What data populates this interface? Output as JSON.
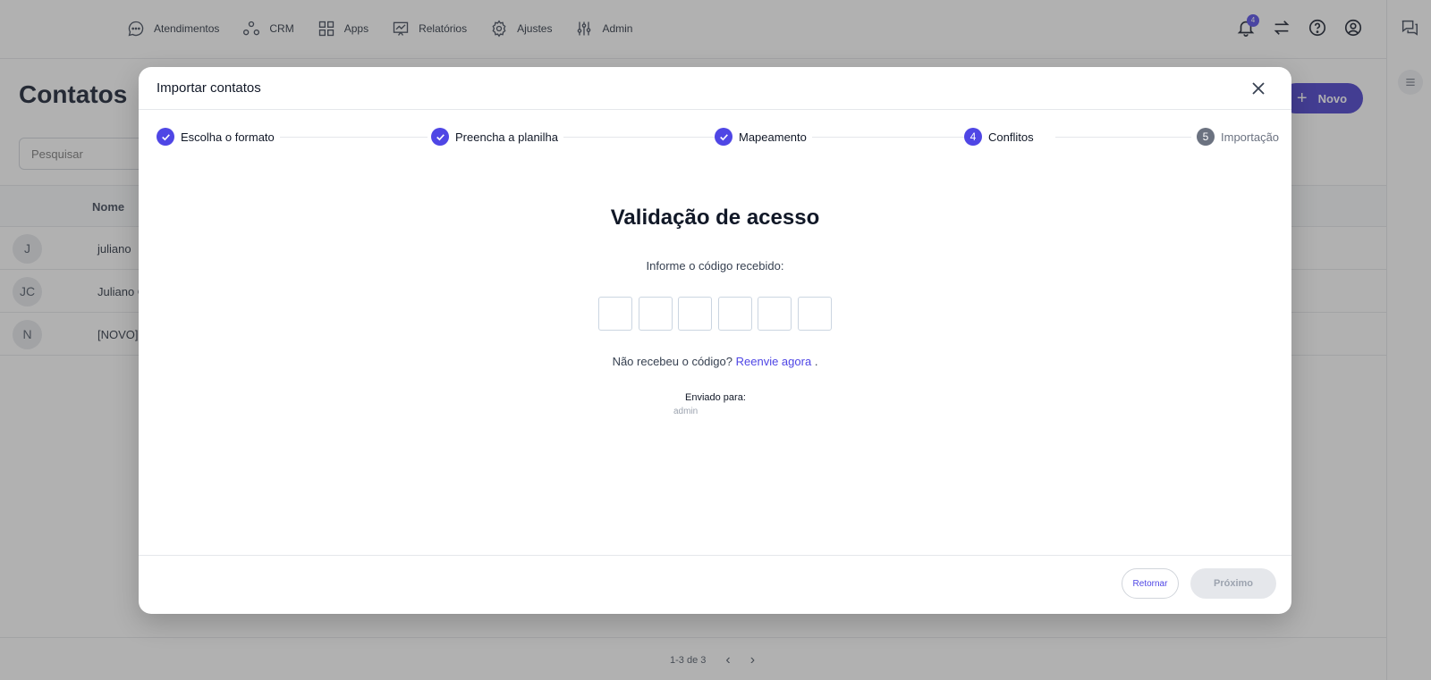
{
  "nav": {
    "items": [
      {
        "label": "Atendimentos",
        "icon": "chat-bubble-icon"
      },
      {
        "label": "CRM",
        "icon": "nodes-icon"
      },
      {
        "label": "Apps",
        "icon": "grid-icon"
      },
      {
        "label": "Relatórios",
        "icon": "chart-board-icon"
      },
      {
        "label": "Ajustes",
        "icon": "gear-icon"
      },
      {
        "label": "Admin",
        "icon": "sliders-icon"
      }
    ],
    "notification_count": "4"
  },
  "page": {
    "title": "Contatos",
    "new_label": "Novo",
    "search_placeholder": "Pesquisar",
    "table": {
      "column_name": "Nome",
      "rows": [
        {
          "initials": "J",
          "name": "juliano"
        },
        {
          "initials": "JC",
          "name": "Juliano C"
        },
        {
          "initials": "N",
          "name": "[NOVO]"
        }
      ]
    },
    "pagination": "1-3 de 3"
  },
  "modal": {
    "title": "Importar contatos",
    "steps": [
      {
        "label": "Escolha o formato",
        "status": "done"
      },
      {
        "label": "Preencha a planilha",
        "status": "done"
      },
      {
        "label": "Mapeamento",
        "status": "done"
      },
      {
        "label": "Conflitos",
        "status": "current",
        "number": "4"
      },
      {
        "label": "Importação",
        "status": "pending",
        "number": "5"
      }
    ],
    "validation": {
      "title": "Validação de acesso",
      "subtitle": "Informe o código recebido:",
      "code_length": 6,
      "resend_prefix": "Não recebeu o código?",
      "resend_link": "Reenvie agora",
      "resend_suffix": ".",
      "sent_to_label": "Enviado para:",
      "sent_to_value": "admin"
    },
    "footer": {
      "back_label": "Retornar",
      "next_label": "Próximo"
    }
  },
  "colors": {
    "accent": "#4f46e5",
    "accent_dark": "#4338ca"
  }
}
